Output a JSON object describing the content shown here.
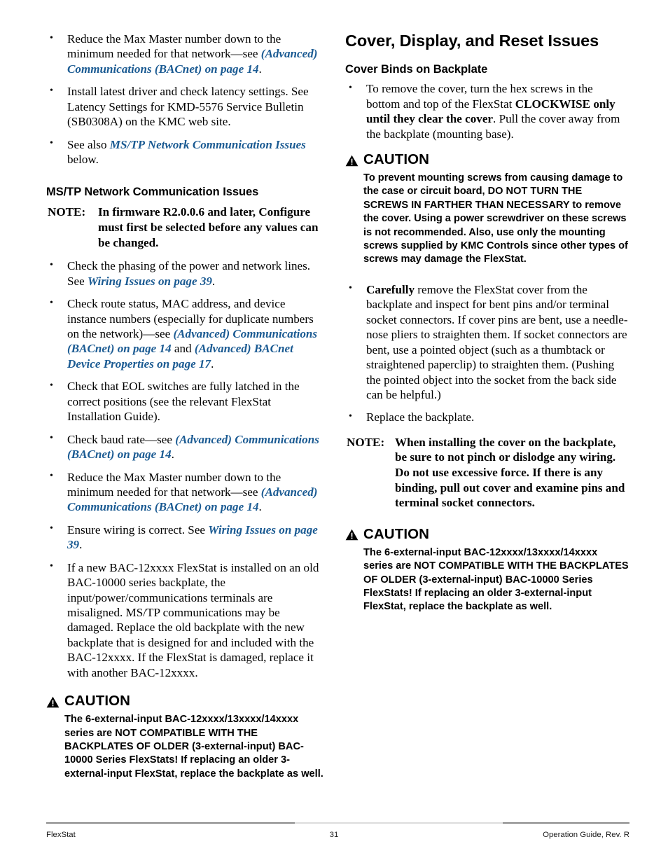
{
  "page": {
    "number": "31",
    "footer_left": "FlexStat",
    "footer_right": "Operation Guide, Rev. R",
    "link_color": "#1a5a92"
  },
  "left_column": {
    "top_bullets": [
      {
        "id": "reduce-max-master",
        "parts": [
          {
            "t": "Reduce the Max Master number down to the minimum needed for that network—see ",
            "s": "plain"
          },
          {
            "t": "(Advanced) Communications (BACnet) on page 14",
            "s": "xref"
          },
          {
            "t": ".",
            "s": "plain"
          }
        ]
      },
      {
        "id": "install-latest-driver",
        "parts": [
          {
            "t": "Install latest driver and check latency settings. See Latency Settings for KMD-5576 Service Bulletin (SB0308A) on the KMC web site.",
            "s": "plain"
          }
        ]
      },
      {
        "id": "see-also-mstp",
        "parts": [
          {
            "t": "See also ",
            "s": "plain"
          },
          {
            "t": "MS/TP Network Communication Issues",
            "s": "xref"
          },
          {
            "t": " below.",
            "s": "plain"
          }
        ]
      }
    ],
    "heading": "MS/TP Network Communication Issues",
    "note": {
      "label": "NOTE:",
      "body": "In firmware R2.0.0.6 and later, Configure must first be selected before any values can be changed."
    },
    "bullets": [
      {
        "id": "check-phasing",
        "parts": [
          {
            "t": "Check the phasing of the power and network lines. See ",
            "s": "plain"
          },
          {
            "t": "Wiring Issues on page 39",
            "s": "xref"
          },
          {
            "t": ".",
            "s": "plain"
          }
        ]
      },
      {
        "id": "check-route-status",
        "parts": [
          {
            "t": "Check route status, MAC address, and device instance numbers (especially for duplicate numbers on the network)—see ",
            "s": "plain"
          },
          {
            "t": "(Advanced) Communications (BACnet) on page 14",
            "s": "xref"
          },
          {
            "t": " and ",
            "s": "plain"
          },
          {
            "t": "(Advanced) BACnet Device Properties on page 17",
            "s": "xref"
          },
          {
            "t": ".",
            "s": "plain"
          }
        ]
      },
      {
        "id": "check-eol-switches",
        "parts": [
          {
            "t": "Check that EOL switches are fully latched in the correct positions (see the relevant FlexStat Installation Guide).",
            "s": "plain"
          }
        ]
      },
      {
        "id": "check-baud-rate",
        "parts": [
          {
            "t": "Check baud rate—see ",
            "s": "plain"
          },
          {
            "t": "(Advanced) Communications (BACnet) on page 14",
            "s": "xref"
          },
          {
            "t": ".",
            "s": "plain"
          }
        ]
      },
      {
        "id": "reduce-max-master-2",
        "parts": [
          {
            "t": "Reduce the Max Master number down to the minimum needed for that network—see ",
            "s": "plain"
          },
          {
            "t": "(Advanced) Communications (BACnet) on page 14",
            "s": "xref"
          },
          {
            "t": ".",
            "s": "plain"
          }
        ]
      },
      {
        "id": "ensure-wiring-correct",
        "parts": [
          {
            "t": "Ensure wiring is correct. See ",
            "s": "plain"
          },
          {
            "t": "Wiring Issues on page 39",
            "s": "xref"
          },
          {
            "t": ".",
            "s": "plain"
          }
        ]
      },
      {
        "id": "new-bac12xxxx-on-old-backplate",
        "parts": [
          {
            "t": "If a new BAC-12xxxx FlexStat is installed on an old BAC-10000 series backplate, the input/power/communications terminals are misaligned. MS/TP communications may be damaged. Replace the old backplate with the new backplate that is designed for and included with the BAC-12xxxx. If the FlexStat is damaged, replace it with another BAC-12xxxx.",
            "s": "plain"
          }
        ]
      }
    ],
    "caution": {
      "label": "CAUTION",
      "body": "The 6-external-input BAC-12xxxx/13xxxx/14xxxx series are NOT COMPATIBLE WITH THE BACKPLATES OF OLDER (3-external-input) BAC-10000 Series FlexStats! If replacing an older 3-external-input FlexStat, replace the backplate as well."
    }
  },
  "right_column": {
    "heading": "Cover, Display, and Reset Issues",
    "subheading": "Cover Binds on Backplate",
    "bullet_remove_cover": {
      "id": "remove-cover",
      "parts": [
        {
          "t": "To remove the cover, turn the hex screws in the bottom and top of the FlexStat ",
          "s": "plain"
        },
        {
          "t": "CLOCKWISE only until they clear the cover",
          "s": "bold"
        },
        {
          "t": ". Pull the cover away from the backplate (mounting base).",
          "s": "plain"
        }
      ]
    },
    "caution_1": {
      "label": "CAUTION",
      "body": "To prevent mounting screws from causing damage to the case or circuit board, DO NOT TURN THE SCREWS IN FARTHER THAN NECESSARY to remove the cover. Using a power screwdriver on these screws is not recommended. Also, use only the mounting screws supplied by KMC Controls since other types of screws may damage the FlexStat."
    },
    "bullets": [
      {
        "id": "carefully-remove-cover",
        "parts": [
          {
            "t": "Carefully",
            "s": "bold"
          },
          {
            "t": " remove the FlexStat cover from the backplate and inspect for bent pins and/or terminal socket connectors. If cover pins are bent, use a needle-nose pliers to straighten them. If socket connectors are bent, use a pointed object (such as a thumbtack or straightened paperclip) to straighten them. (Pushing the pointed object into the socket from the back side can be helpful.)",
            "s": "plain"
          }
        ]
      },
      {
        "id": "replace-backplate",
        "parts": [
          {
            "t": "Replace the backplate.",
            "s": "plain"
          }
        ]
      }
    ],
    "note": {
      "label": "NOTE:",
      "body": "When installing the cover on the backplate, be sure to not pinch or dislodge any wiring. Do not use excessive force. If there is any binding, pull out cover and examine pins and terminal socket connectors."
    },
    "caution_2": {
      "label": "CAUTION",
      "body": "The 6-external-input BAC-12xxxx/13xxxx/14xxxx series are NOT COMPATIBLE WITH THE BACKPLATES OF OLDER (3-external-input) BAC-10000 Series FlexStats! If replacing an older 3-external-input FlexStat, replace the backplate as well."
    }
  }
}
